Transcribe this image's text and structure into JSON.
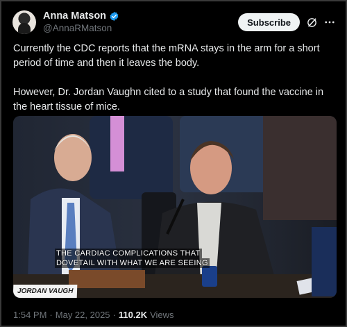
{
  "author": {
    "display_name": "Anna Matson",
    "handle": "@AnnaRMatson",
    "verified": true,
    "verified_color": "#1d9bf0"
  },
  "header": {
    "subscribe_label": "Subscribe",
    "grok_icon": "grok-icon",
    "more_icon": "more-icon"
  },
  "post": {
    "paragraphs": [
      "Currently the CDC reports that the mRNA stays in the arm for a short period of time and then it leaves the body.",
      "However, Dr. Jordan Vaughn cited to a study that found the vaccine in the heart tissue of mice."
    ]
  },
  "media": {
    "caption_line1": "THE CARDIAC COMPLICATIONS THAT",
    "caption_line2": "DOVETAIL WITH WHAT WE ARE SEEING",
    "nameplate": "JORDAN VAUGH"
  },
  "meta": {
    "time": "1:54 PM",
    "separator1": "·",
    "date": "May 22, 2025",
    "separator2": "·",
    "views_count": "110.2K",
    "views_label": "Views"
  },
  "colors": {
    "background": "#000000",
    "text": "#e7e9ea",
    "secondary": "#71767b",
    "subscribe_bg": "#eff3f4"
  }
}
